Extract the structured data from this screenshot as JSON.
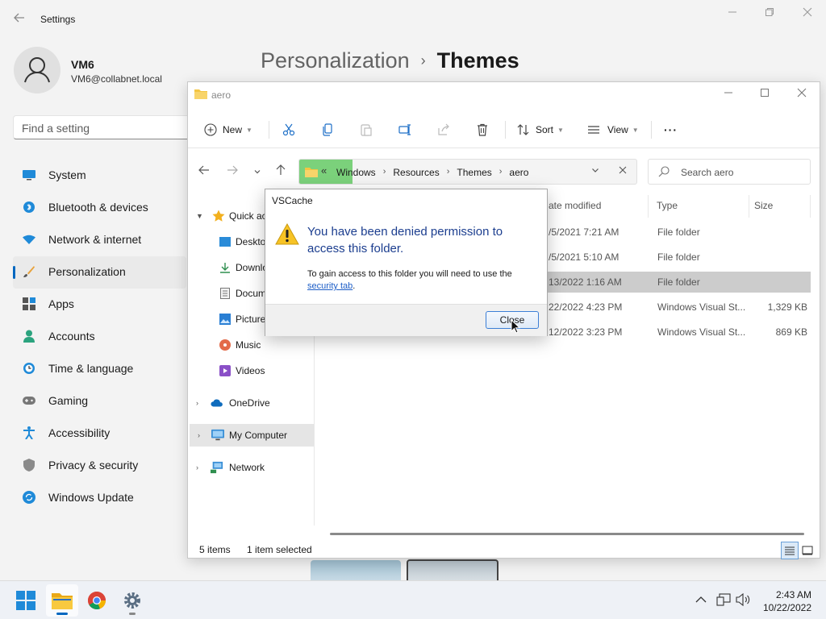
{
  "settings": {
    "window_title": "Settings",
    "user": {
      "name": "VM6",
      "email": "VM6@collabnet.local"
    },
    "search_placeholder": "Find a setting",
    "nav": [
      {
        "label": "System",
        "icon": "monitor-icon"
      },
      {
        "label": "Bluetooth & devices",
        "icon": "bluetooth-icon"
      },
      {
        "label": "Network & internet",
        "icon": "wifi-icon"
      },
      {
        "label": "Personalization",
        "icon": "brush-icon",
        "active": true
      },
      {
        "label": "Apps",
        "icon": "apps-icon"
      },
      {
        "label": "Accounts",
        "icon": "person-icon"
      },
      {
        "label": "Time & language",
        "icon": "clock-globe-icon"
      },
      {
        "label": "Gaming",
        "icon": "gamepad-icon"
      },
      {
        "label": "Accessibility",
        "icon": "accessibility-icon"
      },
      {
        "label": "Privacy & security",
        "icon": "shield-icon"
      },
      {
        "label": "Windows Update",
        "icon": "refresh-icon"
      }
    ],
    "breadcrumb": {
      "parent": "Personalization",
      "separator": "›",
      "current": "Themes"
    }
  },
  "explorer": {
    "window_title": "aero",
    "toolbar": {
      "new_label": "New",
      "sort_label": "Sort",
      "view_label": "View",
      "more_label": "···"
    },
    "address": {
      "overflow": "«",
      "crumbs": [
        "Windows",
        "Resources",
        "Themes",
        "aero"
      ]
    },
    "search_placeholder": "Search aero",
    "tree": [
      {
        "label": "Quick ac",
        "expanded": true
      },
      {
        "label": "Desktop"
      },
      {
        "label": "Downlo"
      },
      {
        "label": "Docum"
      },
      {
        "label": "Picture"
      },
      {
        "label": "Music"
      },
      {
        "label": "Videos"
      },
      {
        "label": "OneDrive"
      },
      {
        "label": "My Computer",
        "selected": true
      },
      {
        "label": "Network"
      }
    ],
    "columns": {
      "date": "ate modified",
      "type": "Type",
      "size": "Size"
    },
    "rows": [
      {
        "date": "/5/2021 7:21 AM",
        "type": "File folder",
        "size": ""
      },
      {
        "date": "/5/2021 5:10 AM",
        "type": "File folder",
        "size": ""
      },
      {
        "date": "13/2022 1:16 AM",
        "type": "File folder",
        "size": "",
        "selected": true
      },
      {
        "date": "22/2022 4:23 PM",
        "type": "Windows Visual St...",
        "size": "1,329 KB"
      },
      {
        "date": "12/2022 3:23 PM",
        "type": "Windows Visual St...",
        "size": "869 KB"
      }
    ],
    "status": {
      "items": "5 items",
      "selected": "1 item selected"
    }
  },
  "dialog": {
    "title": "VSCache",
    "heading": "You have been denied permission to access this folder.",
    "body_text": "To gain access to this folder you will need to use the",
    "link_text": "security tab",
    "body_end": ".",
    "close_label": "Close"
  },
  "taskbar": {
    "time": "2:43 AM",
    "date": "10/22/2022"
  },
  "colors": {
    "accent": "#0067c0",
    "dialog_heading": "#1c3e8f",
    "address_highlight": "#7bd17b"
  }
}
